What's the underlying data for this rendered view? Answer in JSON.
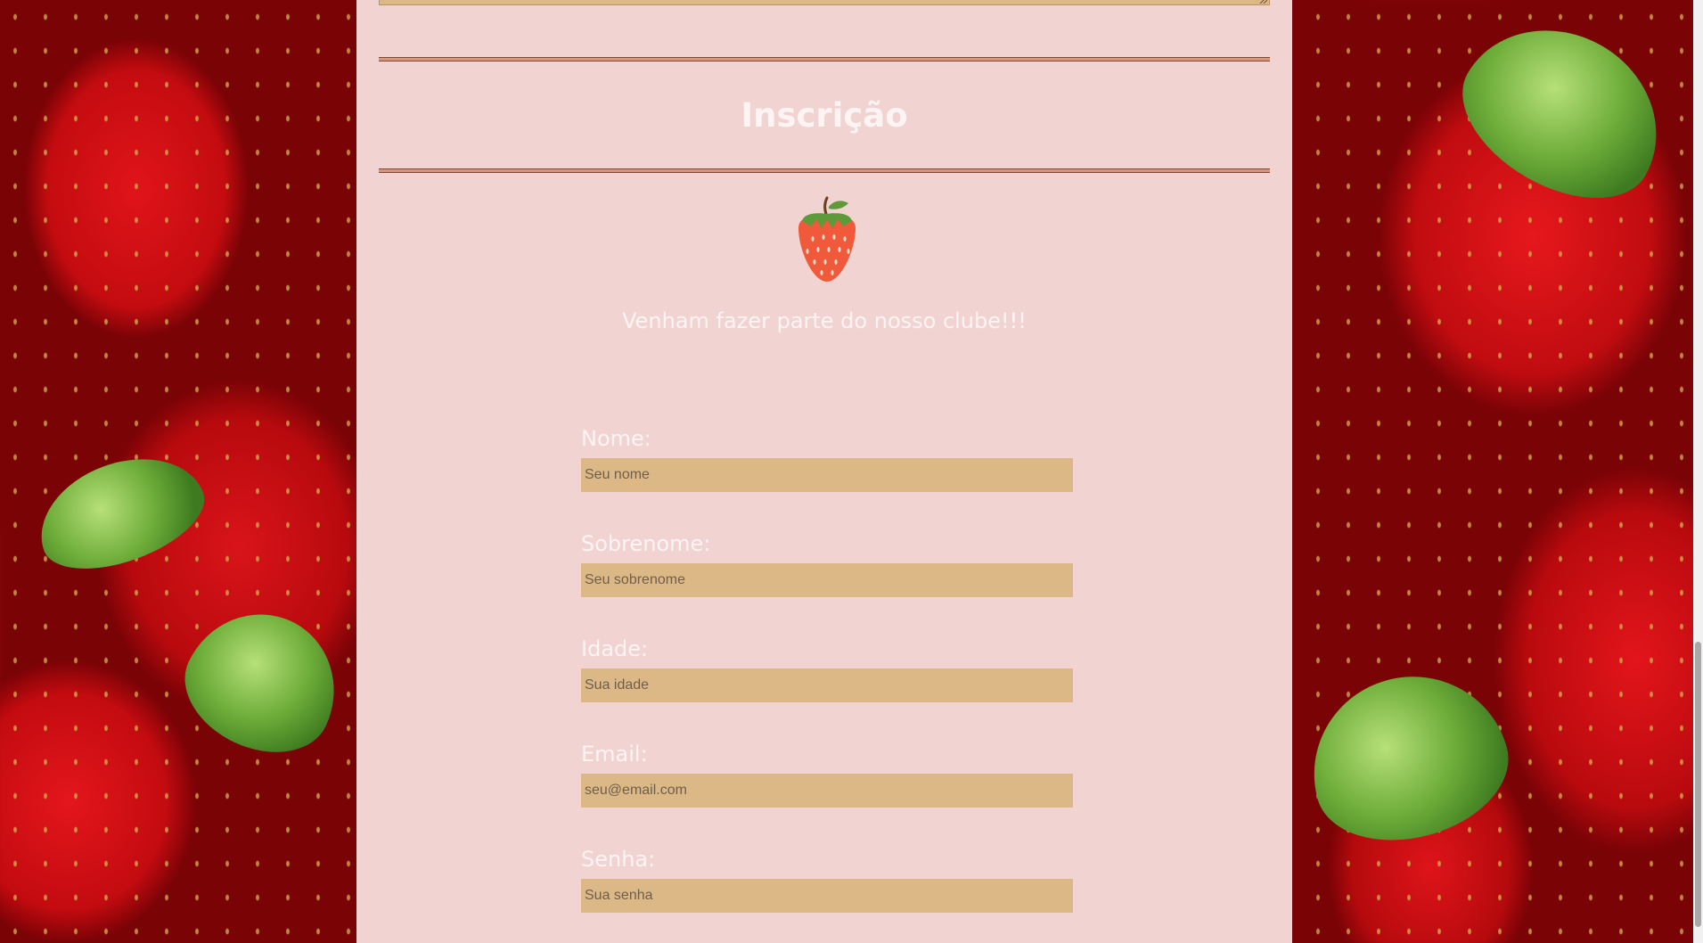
{
  "page": {
    "title": "Inscrição",
    "tagline": "Venham fazer parte do nosso clube!!!",
    "logo_icon": "strawberry-icon"
  },
  "colors": {
    "panel_background": "#f1d3d1",
    "input_background": "#ddb887",
    "text": "#fdf4f3",
    "rule": "#d8957a",
    "strawberry": "#f05a3a",
    "leaf": "#5c9a3a"
  },
  "form": {
    "fields": [
      {
        "label": "Nome:",
        "placeholder": "Seu nome",
        "value": ""
      },
      {
        "label": "Sobrenome:",
        "placeholder": "Seu sobrenome",
        "value": ""
      },
      {
        "label": "Idade:",
        "placeholder": "Sua idade",
        "value": ""
      },
      {
        "label": "Email:",
        "placeholder": "seu@email.com",
        "value": ""
      },
      {
        "label": "Senha:",
        "placeholder": "Sua senha",
        "value": ""
      }
    ]
  }
}
